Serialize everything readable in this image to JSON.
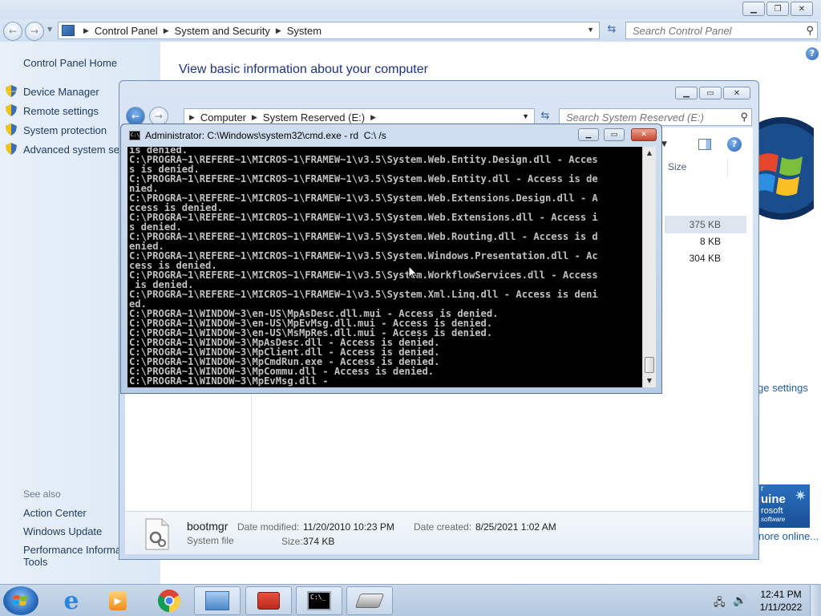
{
  "control_panel": {
    "breadcrumb": [
      "Control Panel",
      "System and Security",
      "System"
    ],
    "search_placeholder": "Search Control Panel",
    "sidebar": {
      "home": "Control Panel Home",
      "links": [
        "Device Manager",
        "Remote settings",
        "System protection",
        "Advanced system setti"
      ],
      "see_also": "See also",
      "see_also_links": [
        "Action Center",
        "Windows Update",
        "Performance Informat",
        "Tools"
      ]
    },
    "heading": "View basic information about your computer",
    "change_settings": "ge settings",
    "genuine_lines": [
      "r",
      "uine",
      "rosoft",
      "software"
    ],
    "more_online": "nore online..."
  },
  "explorer": {
    "breadcrumb": [
      "Computer",
      "System Reserved (E:)"
    ],
    "search_placeholder": "Search System Reserved (E:)",
    "column_size": "Size",
    "sizes": [
      "375 KB",
      "8 KB",
      "304 KB"
    ],
    "details": {
      "name": "bootmgr",
      "type": "System file",
      "modified_label": "Date modified:",
      "modified_value": "11/20/2010 10:23 PM",
      "created_label": "Date created:",
      "created_value": "8/25/2021 1:02 AM",
      "size_label": "Size:",
      "size_value": "374 KB"
    }
  },
  "cmd": {
    "title": "Administrator: C:\\Windows\\system32\\cmd.exe - rd  C:\\ /s",
    "lines": [
      "is denied.",
      "C:\\PROGRA~1\\REFERE~1\\MICROS~1\\FRAMEW~1\\v3.5\\System.Web.Entity.Design.dll - Acces",
      "s is denied.",
      "C:\\PROGRA~1\\REFERE~1\\MICROS~1\\FRAMEW~1\\v3.5\\System.Web.Entity.dll - Access is de",
      "nied.",
      "C:\\PROGRA~1\\REFERE~1\\MICROS~1\\FRAMEW~1\\v3.5\\System.Web.Extensions.Design.dll - A",
      "ccess is denied.",
      "C:\\PROGRA~1\\REFERE~1\\MICROS~1\\FRAMEW~1\\v3.5\\System.Web.Extensions.dll - Access i",
      "s denied.",
      "C:\\PROGRA~1\\REFERE~1\\MICROS~1\\FRAMEW~1\\v3.5\\System.Web.Routing.dll - Access is d",
      "enied.",
      "C:\\PROGRA~1\\REFERE~1\\MICROS~1\\FRAMEW~1\\v3.5\\System.Windows.Presentation.dll - Ac",
      "cess is denied.",
      "C:\\PROGRA~1\\REFERE~1\\MICROS~1\\FRAMEW~1\\v3.5\\System.WorkflowServices.dll - Access",
      " is denied.",
      "C:\\PROGRA~1\\REFERE~1\\MICROS~1\\FRAMEW~1\\v3.5\\System.Xml.Linq.dll - Access is deni",
      "ed.",
      "C:\\PROGRA~1\\WINDOW~3\\en-US\\MpAsDesc.dll.mui - Access is denied.",
      "C:\\PROGRA~1\\WINDOW~3\\en-US\\MpEvMsg.dll.mui - Access is denied.",
      "C:\\PROGRA~1\\WINDOW~3\\en-US\\MsMpRes.dll.mui - Access is denied.",
      "C:\\PROGRA~1\\WINDOW~3\\MpAsDesc.dll - Access is denied.",
      "C:\\PROGRA~1\\WINDOW~3\\MpClient.dll - Access is denied.",
      "C:\\PROGRA~1\\WINDOW~3\\MpCmdRun.exe - Access is denied.",
      "C:\\PROGRA~1\\WINDOW~3\\MpCommu.dll - Access is denied.",
      "C:\\PROGRA~1\\WINDOW~3\\MpEvMsg.dll -"
    ]
  },
  "taskbar": {
    "apps": [
      {
        "icon": "internet-explorer-icon",
        "open": false
      },
      {
        "icon": "media-player-icon",
        "open": false
      },
      {
        "icon": "chrome-icon",
        "open": false
      },
      {
        "icon": "control-panel-icon",
        "open": true
      },
      {
        "icon": "toolbox-icon",
        "open": true
      },
      {
        "icon": "cmd-icon",
        "open": true
      },
      {
        "icon": "drive-icon",
        "open": true
      }
    ],
    "time": "12:41 PM",
    "date": "1/11/2022"
  },
  "colors": {
    "link": "#1e3a5f",
    "heading": "#1e3287",
    "console_bg": "#000000",
    "console_text": "#c0c0c0"
  }
}
